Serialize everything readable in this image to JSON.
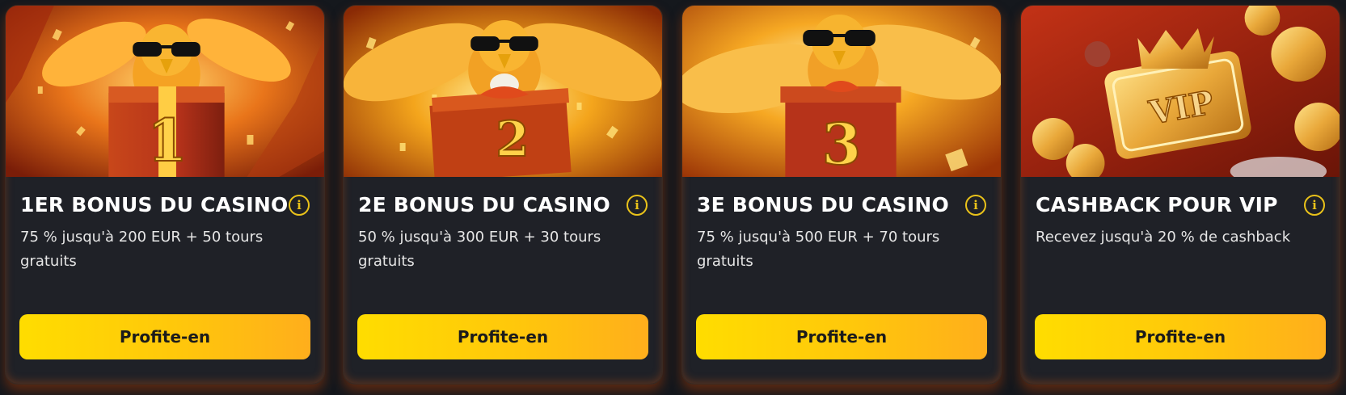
{
  "colors": {
    "page_background": "#15181d",
    "card_background": "#1f2127",
    "accent_yellow": "#ffd400",
    "info_icon": "#e9c21a"
  },
  "cards": [
    {
      "title": "1ER BONUS DU CASINO",
      "description": "75 % jusqu'à 200 EUR + 50 tours gratuits",
      "button_label": "Profite-en",
      "image_number": "1",
      "image_subject": "eagle with sunglasses on gift box"
    },
    {
      "title": "2E BONUS DU CASINO",
      "description": "50 % jusqu'à 300 EUR + 30 tours gratuits",
      "button_label": "Profite-en",
      "image_number": "2",
      "image_subject": "eagle with sunglasses on gift box"
    },
    {
      "title": "3E BONUS DU CASINO",
      "description": "75 % jusqu'à 500 EUR + 70 tours gratuits",
      "button_label": "Profite-en",
      "image_number": "3",
      "image_subject": "eagle with sunglasses on gift box"
    },
    {
      "title": "CASHBACK POUR VIP",
      "description": "Recevez jusqu'à 20 % de cashback",
      "button_label": "Profite-en",
      "image_number": "VIP",
      "image_subject": "gold VIP card with crown and coins"
    }
  ]
}
